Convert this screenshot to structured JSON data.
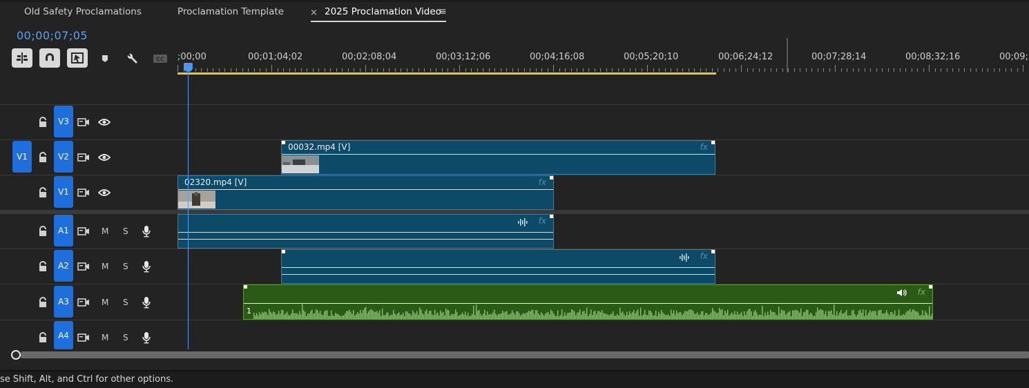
{
  "tabs": [
    {
      "label": "Old Safety Proclamations"
    },
    {
      "label": "Proclamation Template"
    },
    {
      "label": "2025 Proclamation Video",
      "active": true
    }
  ],
  "tab_close_symbol": "×",
  "tab_menu_symbol": "≡",
  "timecode": "00;00;07;05",
  "ruler": {
    "ticks": [
      ";00;00",
      "00;01;04;02",
      "00;02;08;04",
      "00;03;12;06",
      "00;04;16;08",
      "00;05;20;10",
      "00;06;24;12",
      "00;07;28;14",
      "00;08;32;16",
      "00;09;3"
    ]
  },
  "source_patch": {
    "label": "V1"
  },
  "tracks": {
    "video": [
      {
        "label": "V3"
      },
      {
        "label": "V2"
      },
      {
        "label": "V1"
      }
    ],
    "audio": [
      {
        "label": "A1",
        "mute": "M",
        "solo": "S"
      },
      {
        "label": "A2",
        "mute": "M",
        "solo": "S"
      },
      {
        "label": "A3",
        "mute": "M",
        "solo": "S"
      },
      {
        "label": "A4",
        "mute": "M",
        "solo": "S"
      }
    ]
  },
  "clips": {
    "v2": {
      "name": "00032.mp4 [V]",
      "fx": "fx"
    },
    "v1": {
      "name": "02320.mp4 [V]",
      "fx": "fx"
    },
    "a1": {
      "fx": "fx"
    },
    "a2": {
      "fx": "fx"
    },
    "a3": {
      "fx": "fx",
      "number": "1"
    }
  },
  "status": {
    "text": "se Shift, Alt, and Ctrl for other options."
  },
  "colors": {
    "accent_blue": "#1e6fdb",
    "timecode_blue": "#5ea2e8",
    "clip_video": "#0d4a68",
    "clip_audio_music": "#2a5a16",
    "waveform": "#8bc36a",
    "work_area": "#e2cf2c"
  },
  "icons": [
    "insert-snap-icon",
    "linked-selection-icon",
    "add-marker-tool-icon",
    "marker-icon",
    "wrench-icon",
    "captions-icon",
    "lock-icon",
    "toggle-sync-icon",
    "eye-icon",
    "microphone-icon",
    "audio-waveform-icon",
    "speaker-icon"
  ]
}
